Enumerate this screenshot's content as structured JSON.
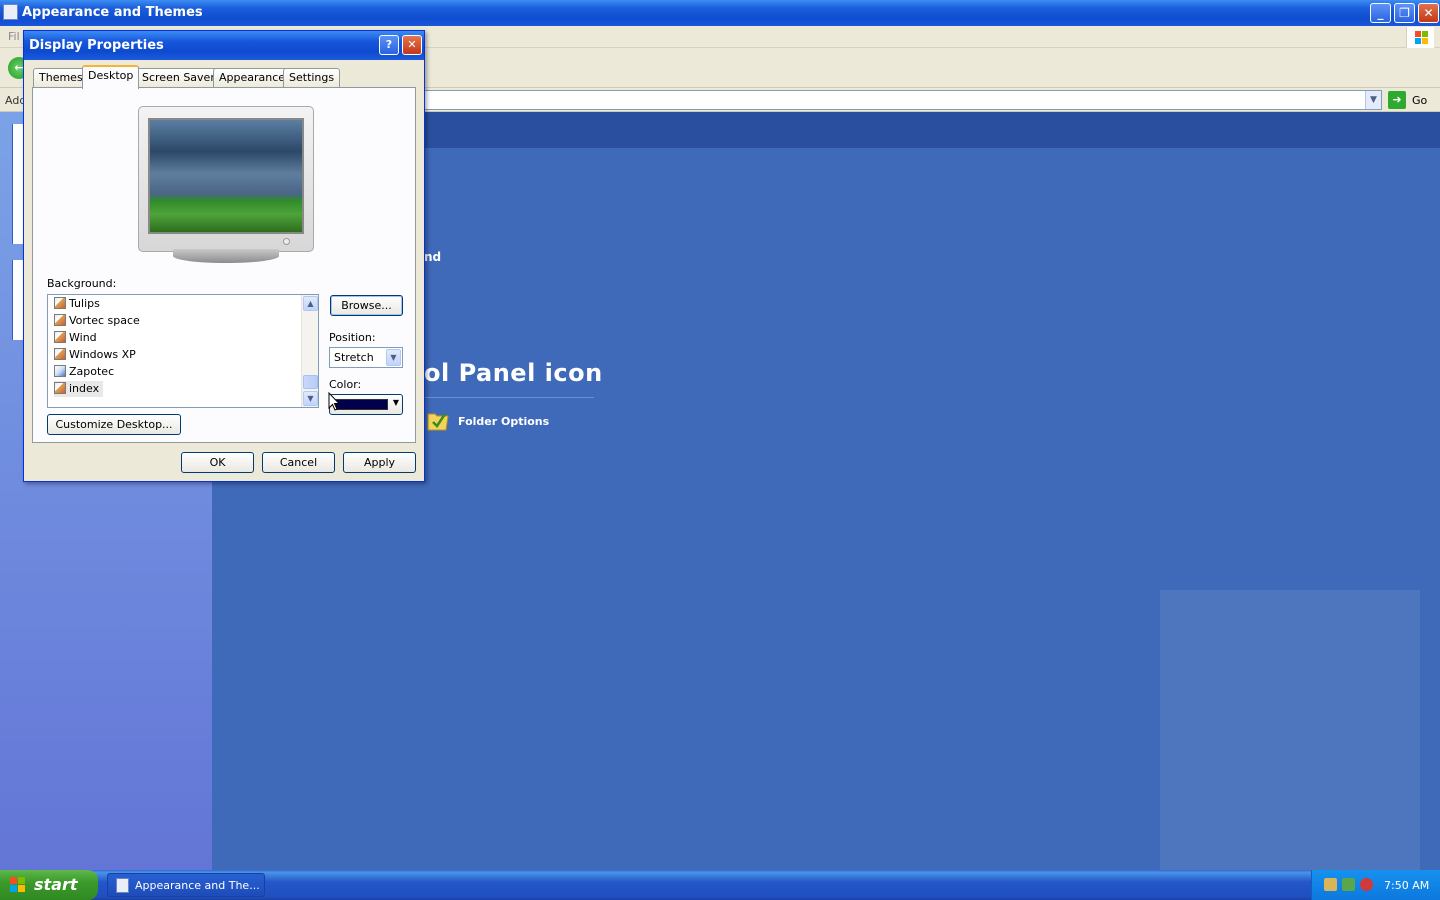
{
  "background_window": {
    "title": "Appearance and Themes",
    "menu_text": "Fil",
    "address_label": "Add",
    "go_label": "Go",
    "main_text_fragment": "nd",
    "heading_fragment": "ol Panel icon",
    "folder_options_label": "Folder Options"
  },
  "dialog": {
    "title": "Display Properties",
    "help_glyph": "?",
    "close_glyph": "✕",
    "tabs": [
      "Themes",
      "Desktop",
      "Screen Saver",
      "Appearance",
      "Settings"
    ],
    "active_tab": "Desktop",
    "background_label": "Background:",
    "background_items": [
      {
        "label": "Tulips",
        "selected": false
      },
      {
        "label": "Vortec space",
        "selected": false
      },
      {
        "label": "Wind",
        "selected": false
      },
      {
        "label": "Windows XP",
        "selected": false
      },
      {
        "label": "Zapotec",
        "selected": false
      },
      {
        "label": "index",
        "selected": true
      }
    ],
    "browse_label": "Browse...",
    "position_label": "Position:",
    "position_value": "Stretch",
    "color_label": "Color:",
    "color_value": "#00004d",
    "customize_label": "Customize Desktop...",
    "ok_label": "OK",
    "cancel_label": "Cancel",
    "apply_label": "Apply"
  },
  "taskbar": {
    "start_label": "start",
    "task_label": "Appearance and The...",
    "clock": "7:50 AM"
  },
  "colors": {
    "titlebar": "#0d4ad0",
    "main_bg": "#3f6ab9",
    "taskbar": "#2457ca",
    "start": "#3c9a2c"
  }
}
